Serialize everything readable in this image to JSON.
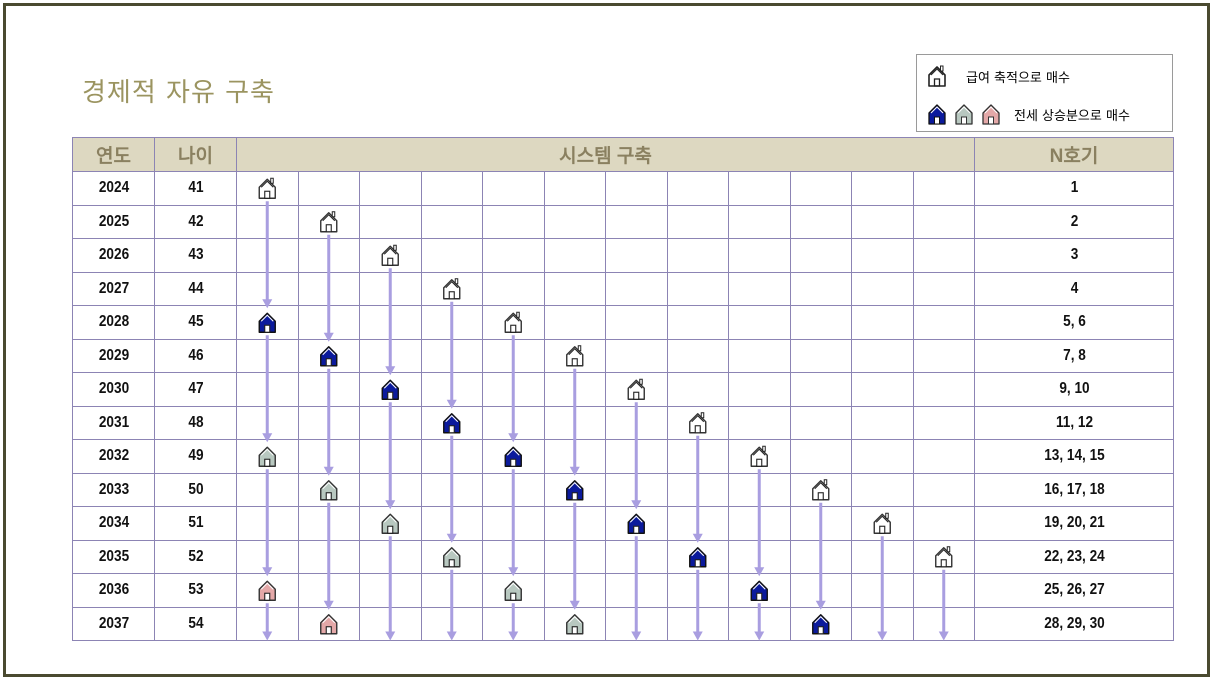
{
  "title": "경제적 자유 구축",
  "legend": {
    "item1_icon": "house-outline-icon",
    "item1_label": "급여 축적으로 매수",
    "item2_icons": [
      "house-blue-icon",
      "house-gray-icon",
      "house-pink-icon"
    ],
    "item2_label": "전세 상승분으로 매수"
  },
  "table": {
    "headers": [
      "연도",
      "나이",
      "시스템 구축",
      "N호기"
    ],
    "rows": [
      {
        "year": "2024",
        "age": "41",
        "units": "1"
      },
      {
        "year": "2025",
        "age": "42",
        "units": "2"
      },
      {
        "year": "2026",
        "age": "43",
        "units": "3"
      },
      {
        "year": "2027",
        "age": "44",
        "units": "4"
      },
      {
        "year": "2028",
        "age": "45",
        "units": "5, 6"
      },
      {
        "year": "2029",
        "age": "46",
        "units": "7, 8"
      },
      {
        "year": "2030",
        "age": "47",
        "units": "9, 10"
      },
      {
        "year": "2031",
        "age": "48",
        "units": "11, 12"
      },
      {
        "year": "2032",
        "age": "49",
        "units": "13, 14, 15"
      },
      {
        "year": "2033",
        "age": "50",
        "units": "16, 17, 18"
      },
      {
        "year": "2034",
        "age": "51",
        "units": "19, 20, 21"
      },
      {
        "year": "2035",
        "age": "52",
        "units": "22, 23, 24"
      },
      {
        "year": "2036",
        "age": "53",
        "units": "25, 26, 27"
      },
      {
        "year": "2037",
        "age": "54",
        "units": "28, 29, 30"
      }
    ],
    "system_columns": 12
  },
  "colors": {
    "outline_house": "#ffffff",
    "blue_house": "#0b1a9c",
    "gray_house": "#b8c8c0",
    "pink_house": "#e4a8a8",
    "arrow": "#a99ee0",
    "header_bg": "#ddd8c1"
  },
  "houses": [
    {
      "row": 0,
      "col": 0,
      "type": "outline"
    },
    {
      "row": 1,
      "col": 1,
      "type": "outline"
    },
    {
      "row": 2,
      "col": 2,
      "type": "outline"
    },
    {
      "row": 3,
      "col": 3,
      "type": "outline"
    },
    {
      "row": 4,
      "col": 0,
      "type": "blue"
    },
    {
      "row": 4,
      "col": 4,
      "type": "outline"
    },
    {
      "row": 5,
      "col": 1,
      "type": "blue"
    },
    {
      "row": 5,
      "col": 5,
      "type": "outline"
    },
    {
      "row": 6,
      "col": 2,
      "type": "blue"
    },
    {
      "row": 6,
      "col": 6,
      "type": "outline"
    },
    {
      "row": 7,
      "col": 3,
      "type": "blue"
    },
    {
      "row": 7,
      "col": 7,
      "type": "outline"
    },
    {
      "row": 8,
      "col": 0,
      "type": "gray"
    },
    {
      "row": 8,
      "col": 4,
      "type": "blue"
    },
    {
      "row": 8,
      "col": 8,
      "type": "outline"
    },
    {
      "row": 9,
      "col": 1,
      "type": "gray"
    },
    {
      "row": 9,
      "col": 5,
      "type": "blue"
    },
    {
      "row": 9,
      "col": 9,
      "type": "outline"
    },
    {
      "row": 10,
      "col": 2,
      "type": "gray"
    },
    {
      "row": 10,
      "col": 6,
      "type": "blue"
    },
    {
      "row": 10,
      "col": 10,
      "type": "outline"
    },
    {
      "row": 11,
      "col": 3,
      "type": "gray"
    },
    {
      "row": 11,
      "col": 7,
      "type": "blue"
    },
    {
      "row": 11,
      "col": 11,
      "type": "outline"
    },
    {
      "row": 12,
      "col": 0,
      "type": "pink"
    },
    {
      "row": 12,
      "col": 4,
      "type": "gray"
    },
    {
      "row": 12,
      "col": 8,
      "type": "blue"
    },
    {
      "row": 13,
      "col": 1,
      "type": "pink"
    },
    {
      "row": 13,
      "col": 5,
      "type": "gray"
    },
    {
      "row": 13,
      "col": 9,
      "type": "blue"
    }
  ]
}
